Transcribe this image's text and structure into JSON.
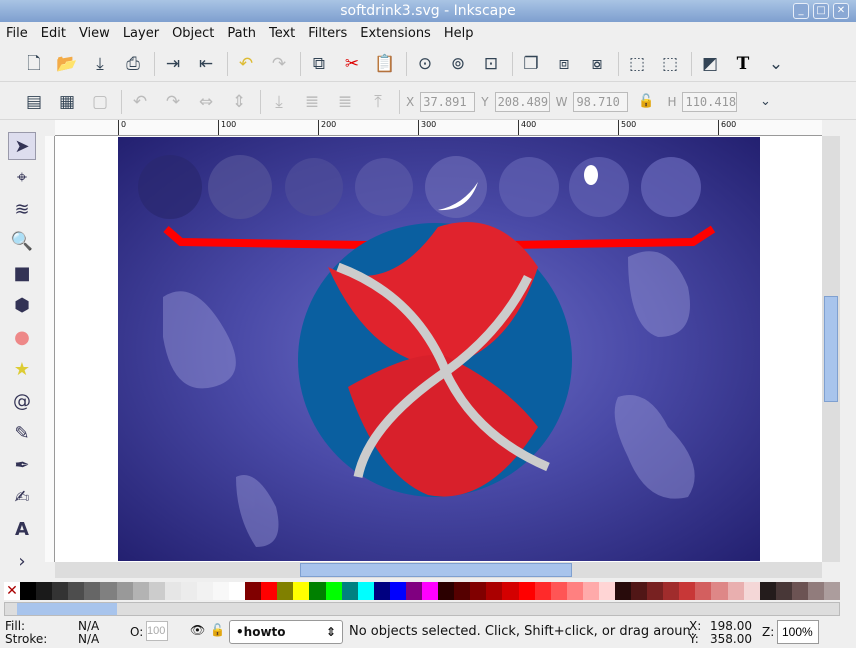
{
  "window": {
    "title": "softdrink3.svg - Inkscape"
  },
  "menu": [
    "File",
    "Edit",
    "View",
    "Layer",
    "Object",
    "Path",
    "Text",
    "Filters",
    "Extensions",
    "Help"
  ],
  "toolbar1": [
    "new-icon",
    "open-icon",
    "save-icon",
    "print-icon",
    "import-icon",
    "export-icon",
    "undo-icon",
    "redo-icon",
    "copy-icon",
    "cut-icon",
    "paste-icon",
    "zoom-selection-icon",
    "zoom-drawing-icon",
    "zoom-page-icon",
    "duplicate-icon",
    "clone-icon",
    "unlink-clone-icon",
    "group-icon",
    "ungroup-icon",
    "fill-stroke-icon",
    "text-icon"
  ],
  "coords": {
    "x_label": "X",
    "x": "37.891",
    "y_label": "Y",
    "y": "208.489",
    "w_label": "W",
    "w": "98.710",
    "h_label": "H",
    "h": "110.418"
  },
  "ruler_ticks": [
    "0",
    "100",
    "200",
    "300",
    "400",
    "500",
    "600"
  ],
  "palette": [
    "#000000",
    "#1a1a1a",
    "#333333",
    "#4d4d4d",
    "#666666",
    "#808080",
    "#999999",
    "#b3b3b3",
    "#cccccc",
    "#e6e6e6",
    "#ececec",
    "#f2f2f2",
    "#f8f8f8",
    "#ffffff",
    "#800000",
    "#ff0000",
    "#808000",
    "#ffff00",
    "#008000",
    "#00ff00",
    "#008080",
    "#00ffff",
    "#000080",
    "#0000ff",
    "#800080",
    "#ff00ff",
    "#2b0000",
    "#550000",
    "#800000",
    "#aa0000",
    "#d40000",
    "#ff0000",
    "#ff2a2a",
    "#ff5555",
    "#ff8080",
    "#ffaaaa",
    "#ffd5d5",
    "#280b0b",
    "#501616",
    "#782121",
    "#a02c2c",
    "#c83737",
    "#d35f5f",
    "#de8787",
    "#e9afaf",
    "#f4d7d7",
    "#241c1c",
    "#483737",
    "#6c5353",
    "#917c7c",
    "#ac9d9d"
  ],
  "status": {
    "fill_label": "Fill:",
    "fill": "N/A",
    "stroke_label": "Stroke:",
    "stroke": "N/A",
    "opacity_label": "O:",
    "opacity": "100",
    "layer": "•howto",
    "message": "No objects selected. Click, Shift+click, or drag aroun.",
    "cx_label": "X:",
    "cx": "198.00",
    "cy_label": "Y:",
    "cy": "358.00",
    "zoom_label": "Z:",
    "zoom": "100%"
  }
}
